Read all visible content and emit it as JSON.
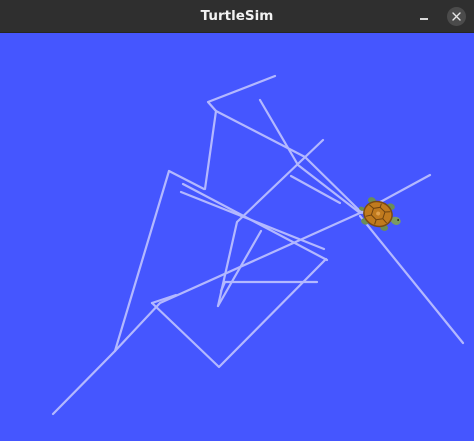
{
  "window": {
    "title": "TurtleSim"
  },
  "titlebar_buttons": {
    "minimize_icon": "minimize-icon",
    "close_icon": "close-icon"
  },
  "canvas": {
    "background_color": "#4556ff",
    "pen_color": "#b3b8ff"
  },
  "turtle": {
    "icon": "turtle-icon",
    "shell_color": "#c07a1e"
  }
}
